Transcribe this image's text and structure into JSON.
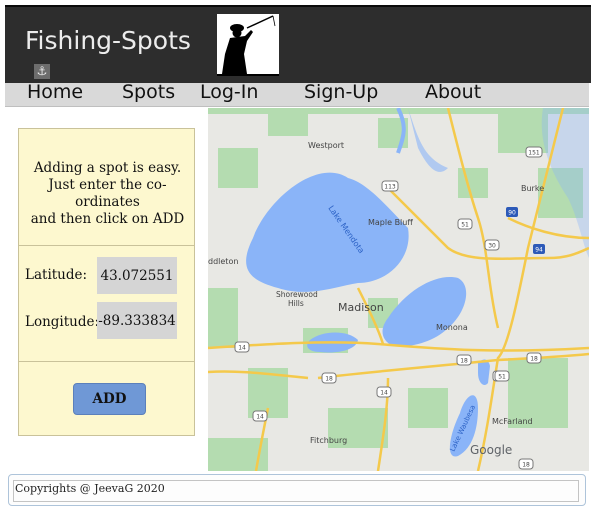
{
  "header": {
    "site_title": "Fishing-Spots",
    "anchor_icon": "anchor-icon",
    "logo": "fisherman-silhouette-logo"
  },
  "nav": {
    "items": [
      "Home",
      "Spots",
      "Log-In",
      "Sign-Up",
      "About"
    ]
  },
  "add_spot": {
    "instructions": "Adding a spot is easy.\nJust enter the co-ordinates\nand then click on ADD",
    "latitude_label": "Latitude:",
    "latitude_value": "43.072551",
    "longitude_label": "Longitude:",
    "longitude_value": "-89.333834",
    "add_label": "ADD"
  },
  "map": {
    "labels": {
      "westport": "Westport",
      "burke": "Burke",
      "lake_mendota": "Lake Mendota",
      "maple_bluff": "Maple Bluff",
      "middleton": "ddleton",
      "shorewood_1": "Shorewood",
      "shorewood_2": "Hills",
      "madison": "Madison",
      "monona": "Monona",
      "lake_waubesa": "Lake Waubesa",
      "mcfarland": "McFarland",
      "fitchburg": "Fitchburg",
      "google": "Google"
    },
    "shields": [
      "113",
      "151",
      "90",
      "51",
      "30",
      "94",
      "14",
      "18",
      "151",
      "14",
      "18",
      "51",
      "18",
      "14",
      "18"
    ]
  },
  "footer": {
    "text": "Copyrights @ JeevaG 2020"
  },
  "colors": {
    "header_bg": "#2d2d2d",
    "nav_bg": "#d9d9d9",
    "panel_bg": "#fdf8cf",
    "button_bg": "#6f98d6",
    "water": "#8ab4f8",
    "park": "#a8d5a8"
  }
}
